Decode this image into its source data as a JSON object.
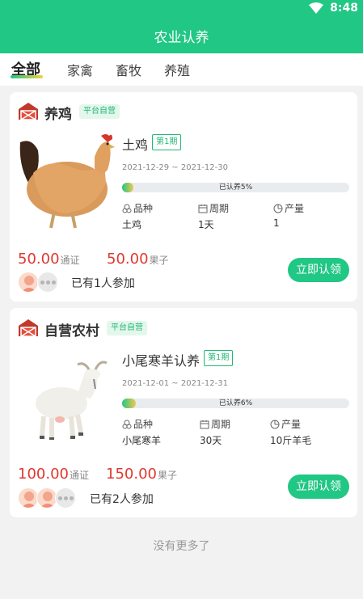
{
  "status_bar": {
    "time": "8:48"
  },
  "header": {
    "title": "农业认养"
  },
  "tabs": [
    {
      "label": "全部",
      "active": true
    },
    {
      "label": "家禽",
      "active": false
    },
    {
      "label": "畜牧",
      "active": false
    },
    {
      "label": "养殖",
      "active": false
    }
  ],
  "colors": {
    "brand": "#21c784",
    "price": "#e0382f",
    "badge_text": "#21b875"
  },
  "items": [
    {
      "store": "养鸡",
      "store_badge": "平台自营",
      "product": "土鸡",
      "period": "第1期",
      "dates": "2021-12-29 ~ 2021-12-30",
      "progress_label": "已认养5%",
      "progress_percent": 5,
      "specs": [
        {
          "icon": "breed-icon",
          "label": "品种",
          "value": "土鸡"
        },
        {
          "icon": "calendar-icon",
          "label": "周期",
          "value": "1天"
        },
        {
          "icon": "pie-icon",
          "label": "产量",
          "value": "1"
        }
      ],
      "price_token": "50.00",
      "price_token_unit": "通证",
      "price_fruit": "50.00",
      "price_fruit_unit": "果子",
      "participants": "已有1人参加",
      "button": "立即认领"
    },
    {
      "store": "自营农村",
      "store_badge": "平台自营",
      "product": "小尾寒羊认养",
      "period": "第1期",
      "dates": "2021-12-01 ~ 2021-12-31",
      "progress_label": "已认养6%",
      "progress_percent": 6,
      "specs": [
        {
          "icon": "breed-icon",
          "label": "品种",
          "value": "小尾寒羊"
        },
        {
          "icon": "calendar-icon",
          "label": "周期",
          "value": "30天"
        },
        {
          "icon": "pie-icon",
          "label": "产量",
          "value": "10斤羊毛"
        }
      ],
      "price_token": "100.00",
      "price_token_unit": "通证",
      "price_fruit": "150.00",
      "price_fruit_unit": "果子",
      "participants": "已有2人参加",
      "button": "立即认领"
    }
  ],
  "footer": {
    "no_more": "没有更多了"
  }
}
